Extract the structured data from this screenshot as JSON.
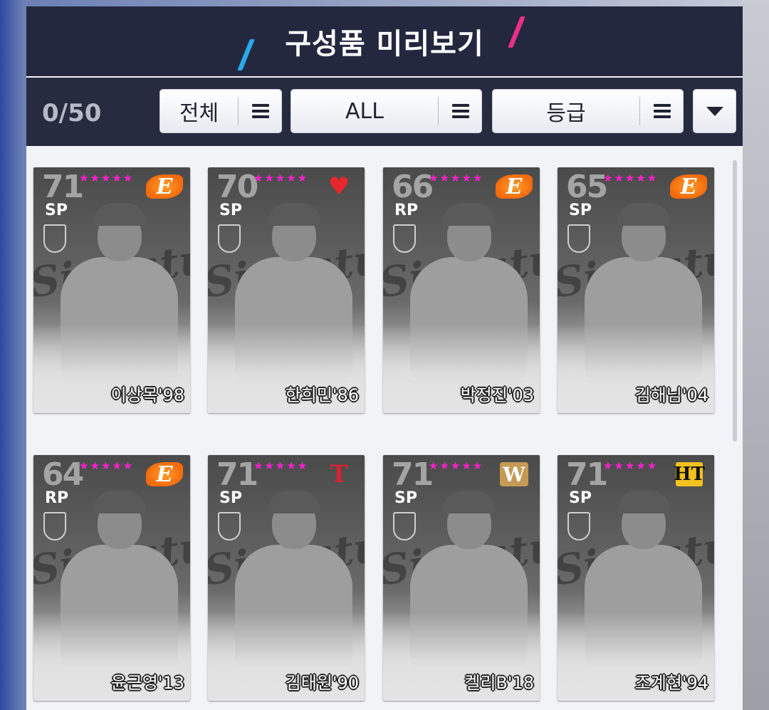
{
  "header": {
    "title": "구성품 미리보기"
  },
  "toolbar": {
    "count": "0/50",
    "filter_team": "전체",
    "filter_year": "ALL",
    "filter_grade": "등급"
  },
  "cards": [
    {
      "ovr": "71",
      "pos": "SP",
      "stars": "★★★★★",
      "logo": "E",
      "name": "이상목'98"
    },
    {
      "ovr": "70",
      "pos": "SP",
      "stars": "★★★★★",
      "logo": "♥",
      "name": "한희민'86"
    },
    {
      "ovr": "66",
      "pos": "RP",
      "stars": "★★★★★",
      "logo": "E",
      "name": "박정진'03"
    },
    {
      "ovr": "65",
      "pos": "SP",
      "stars": "★★★★★",
      "logo": "E",
      "name": "김해님'04"
    },
    {
      "ovr": "64",
      "pos": "RP",
      "stars": "★★★★★",
      "logo": "E",
      "name": "윤근영'13"
    },
    {
      "ovr": "71",
      "pos": "SP",
      "stars": "★★★★★",
      "logo": "T",
      "name": "김태원'90"
    },
    {
      "ovr": "71",
      "pos": "SP",
      "stars": "★★★★★",
      "logo": "W",
      "name": "켈리B'18"
    },
    {
      "ovr": "71",
      "pos": "SP",
      "stars": "★★★★★",
      "logo": "HT",
      "name": "조계현'94"
    }
  ],
  "colors": {
    "header_bg": "#23283f",
    "accent_blue": "#2aa7e8",
    "accent_pink": "#ea2f8a",
    "star": "#ff1fd2"
  }
}
